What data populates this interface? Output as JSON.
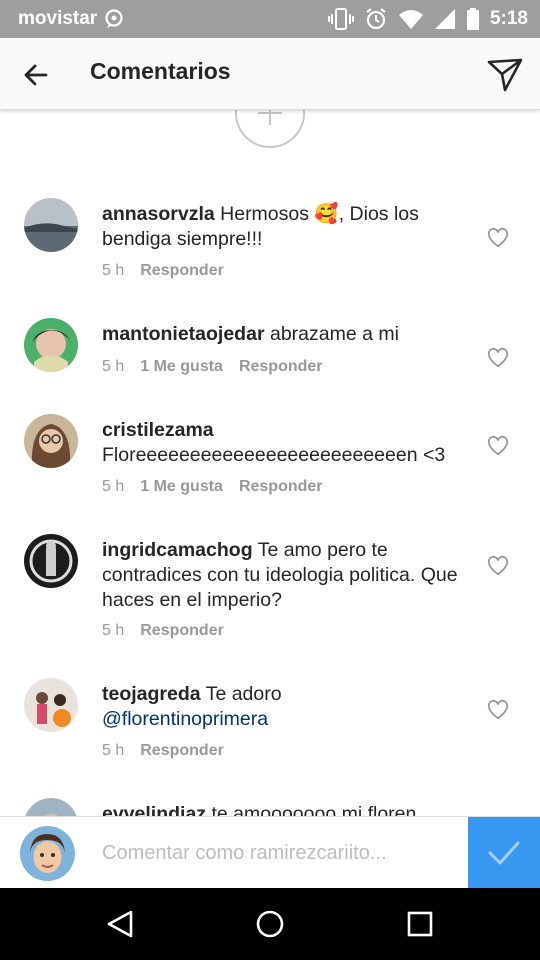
{
  "status_bar": {
    "carrier": "movistar",
    "time": "5:18"
  },
  "header": {
    "title": "Comentarios"
  },
  "comments": [
    {
      "username": "annasorvzla",
      "text": "Hermosos 🥰, Dios los bendiga siempre!!!",
      "time": "5 h",
      "likes": "",
      "reply_label": "Responder"
    },
    {
      "username": "mantonietaojedar",
      "text": "abrazame a mi",
      "time": "5 h",
      "likes": "1 Me gusta",
      "reply_label": "Responder"
    },
    {
      "username": "cristilezama",
      "text": "Floreeeeeeeeeeeeeeeeeeeeeeeeen <3",
      "time": "5 h",
      "likes": "1 Me gusta",
      "reply_label": "Responder"
    },
    {
      "username": "ingridcamachog",
      "text": "Te amo pero te contradices con tu ideologia politica. Que haces en el imperio?",
      "time": "5 h",
      "likes": "",
      "reply_label": "Responder"
    },
    {
      "username": "teojagreda",
      "text": "Te adoro",
      "mention": "@florentinoprimera",
      "time": "5 h",
      "likes": "",
      "reply_label": "Responder"
    },
    {
      "username": "evvelindiaz",
      "text": "te amooooooo mi floren"
    }
  ],
  "compose": {
    "placeholder": "Comentar como ramirezcariito..."
  },
  "colors": {
    "status_bar": "#9e9e9e",
    "accent": "#3897f0",
    "mention": "#003569",
    "meta": "#999999"
  }
}
